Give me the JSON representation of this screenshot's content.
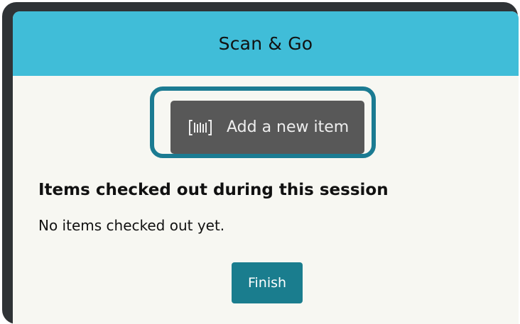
{
  "header": {
    "title": "Scan & Go",
    "background_color": "#40bdd8"
  },
  "add_item": {
    "label": "Add a new item",
    "icon": "barcode-scan-icon",
    "background_color": "#585858",
    "focus_ring_color": "#1b7b92"
  },
  "session": {
    "heading": "Items checked out during this session",
    "empty_message": "No items checked out yet."
  },
  "finish": {
    "label": "Finish",
    "background_color": "#1a7d8e"
  }
}
